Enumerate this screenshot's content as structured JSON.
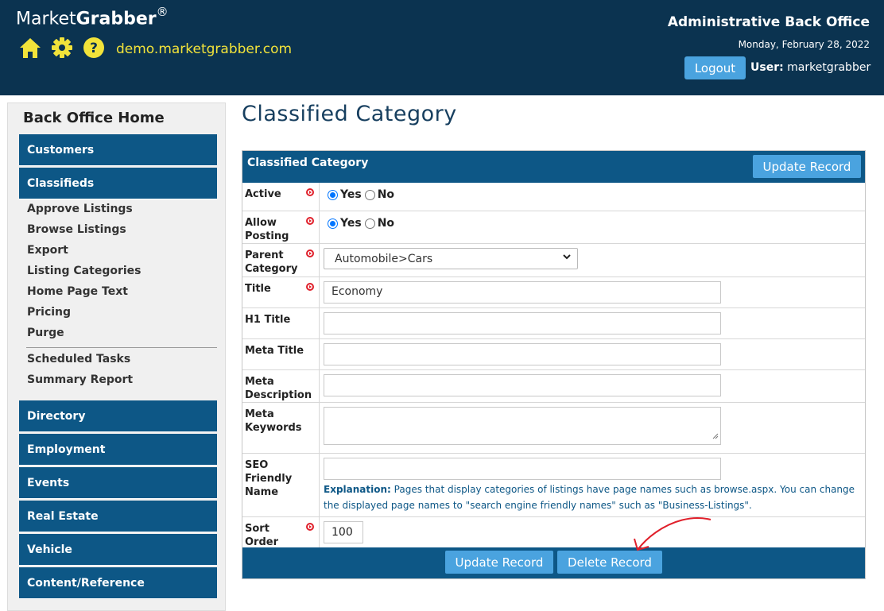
{
  "header": {
    "brand_regular": "Market",
    "brand_bold": "Grabber",
    "brand_mark": "®",
    "site_link": "demo.marketgrabber.com",
    "admin_title": "Administrative Back Office",
    "date": "Monday, February 28, 2022",
    "logout_label": "Logout",
    "user_label": "User:",
    "user_name": "marketgrabber",
    "icons": [
      "home-icon",
      "gear-icon",
      "help-icon"
    ]
  },
  "sidebar": {
    "home_label": "Back Office Home",
    "categories_top": [
      {
        "label": "Customers"
      },
      {
        "label": "Classifieds"
      }
    ],
    "classified_items": [
      {
        "label": "Approve Listings"
      },
      {
        "label": "Browse Listings"
      },
      {
        "label": "Export"
      },
      {
        "label": "Listing Categories"
      },
      {
        "label": "Home Page Text"
      },
      {
        "label": "Pricing"
      },
      {
        "label": "Purge"
      },
      {
        "label": "Scheduled Tasks"
      },
      {
        "label": "Summary Report"
      }
    ],
    "categories_bottom": [
      {
        "label": "Directory"
      },
      {
        "label": "Employment"
      },
      {
        "label": "Events"
      },
      {
        "label": "Real Estate"
      },
      {
        "label": "Vehicle"
      },
      {
        "label": "Content/Reference"
      }
    ]
  },
  "main": {
    "page_title": "Classified Category",
    "panel_title": "Classified Category",
    "update_label": "Update Record",
    "delete_label": "Delete Record",
    "fields": {
      "active": {
        "label": "Active",
        "yes": "Yes",
        "no": "No",
        "selected": "Yes"
      },
      "allow_posting": {
        "label": "Allow Posting",
        "yes": "Yes",
        "no": "No",
        "selected": "Yes"
      },
      "parent_category": {
        "label": "Parent Category",
        "value": "Automobile>Cars"
      },
      "title": {
        "label": "Title",
        "value": "Economy"
      },
      "h1_title": {
        "label": "H1 Title",
        "value": ""
      },
      "meta_title": {
        "label": "Meta Title",
        "value": ""
      },
      "meta_description": {
        "label": "Meta Description",
        "value": ""
      },
      "meta_keywords": {
        "label": "Meta Keywords",
        "value": ""
      },
      "seo_name": {
        "label": "SEO Friendly Name",
        "value": "",
        "explanation_label": "Explanation:",
        "explanation_text": "Pages that display categories of listings have page names such as browse.aspx. You can change the displayed page names to \"search engine friendly names\" such as \"Business-Listings\"."
      },
      "sort_order": {
        "label": "Sort Order",
        "value": "100"
      }
    }
  },
  "colors": {
    "header_bg": "#0b3350",
    "nav_blue": "#0d5786",
    "button_blue": "#4aa3df",
    "link_yellow": "#f2e33a",
    "required_red": "#e0202b",
    "annotation_red": "#e0202b"
  }
}
